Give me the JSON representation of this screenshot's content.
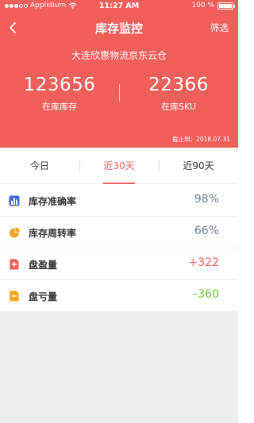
{
  "status_bar": {
    "carrier": "Applidium",
    "time": "11:27 AM",
    "battery": "100 %"
  },
  "nav": {
    "title": "库存监控",
    "filter_label": "筛选"
  },
  "summary": {
    "warehouse": "大连欣惠物流京东云仓",
    "stock_value": "123656",
    "stock_label": "在库库存",
    "sku_value": "22366",
    "sku_label": "在库SKU",
    "as_of": "截止到：2018.07.31"
  },
  "tabs": [
    {
      "label": "今日"
    },
    {
      "label": "近30天"
    },
    {
      "label": "近90天"
    }
  ],
  "metrics": [
    {
      "label": "库存准确率",
      "value": "98%",
      "icon": "bar-chart-icon",
      "icon_color": "#3d6fd8",
      "value_color": "#6e7f9a"
    },
    {
      "label": "库存周转率",
      "value": "66%",
      "icon": "pie-chart-icon",
      "icon_color": "#f5a623",
      "value_color": "#6e7f9a"
    },
    {
      "label": "盘盈量",
      "value": "+322",
      "icon": "document-plus-icon",
      "icon_color": "#f15f5b",
      "value_color": "#f15f5b"
    },
    {
      "label": "盘亏量",
      "value": "–360",
      "icon": "document-minus-icon",
      "icon_color": "#f5a623",
      "value_color": "#68c13b"
    }
  ]
}
